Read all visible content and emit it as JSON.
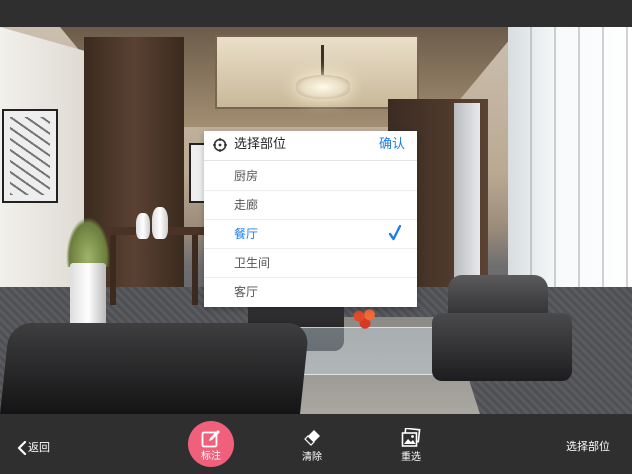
{
  "popup": {
    "title": "选择部位",
    "confirm_label": "确认",
    "options": [
      {
        "label": "厨房",
        "selected": false
      },
      {
        "label": "走廊",
        "selected": false
      },
      {
        "label": "餐厅",
        "selected": true
      },
      {
        "label": "卫生间",
        "selected": false
      },
      {
        "label": "客厅",
        "selected": false
      }
    ]
  },
  "toolbar": {
    "back_label": "返回",
    "mark_label": "标注",
    "clear_label": "清除",
    "reselect_label": "重选",
    "select_part_label": "选择部位"
  },
  "colors": {
    "accent_blue": "#1e7ee8",
    "mark_button_pink": "#f0607b",
    "toolbar_bg": "#2f2f2f"
  },
  "icons": {
    "header": "crosshair-target-icon",
    "selected": "checkmark-icon",
    "back": "chevron-left-icon",
    "mark": "pencil-square-icon",
    "clear": "eraser-icon",
    "reselect": "photos-icon"
  }
}
